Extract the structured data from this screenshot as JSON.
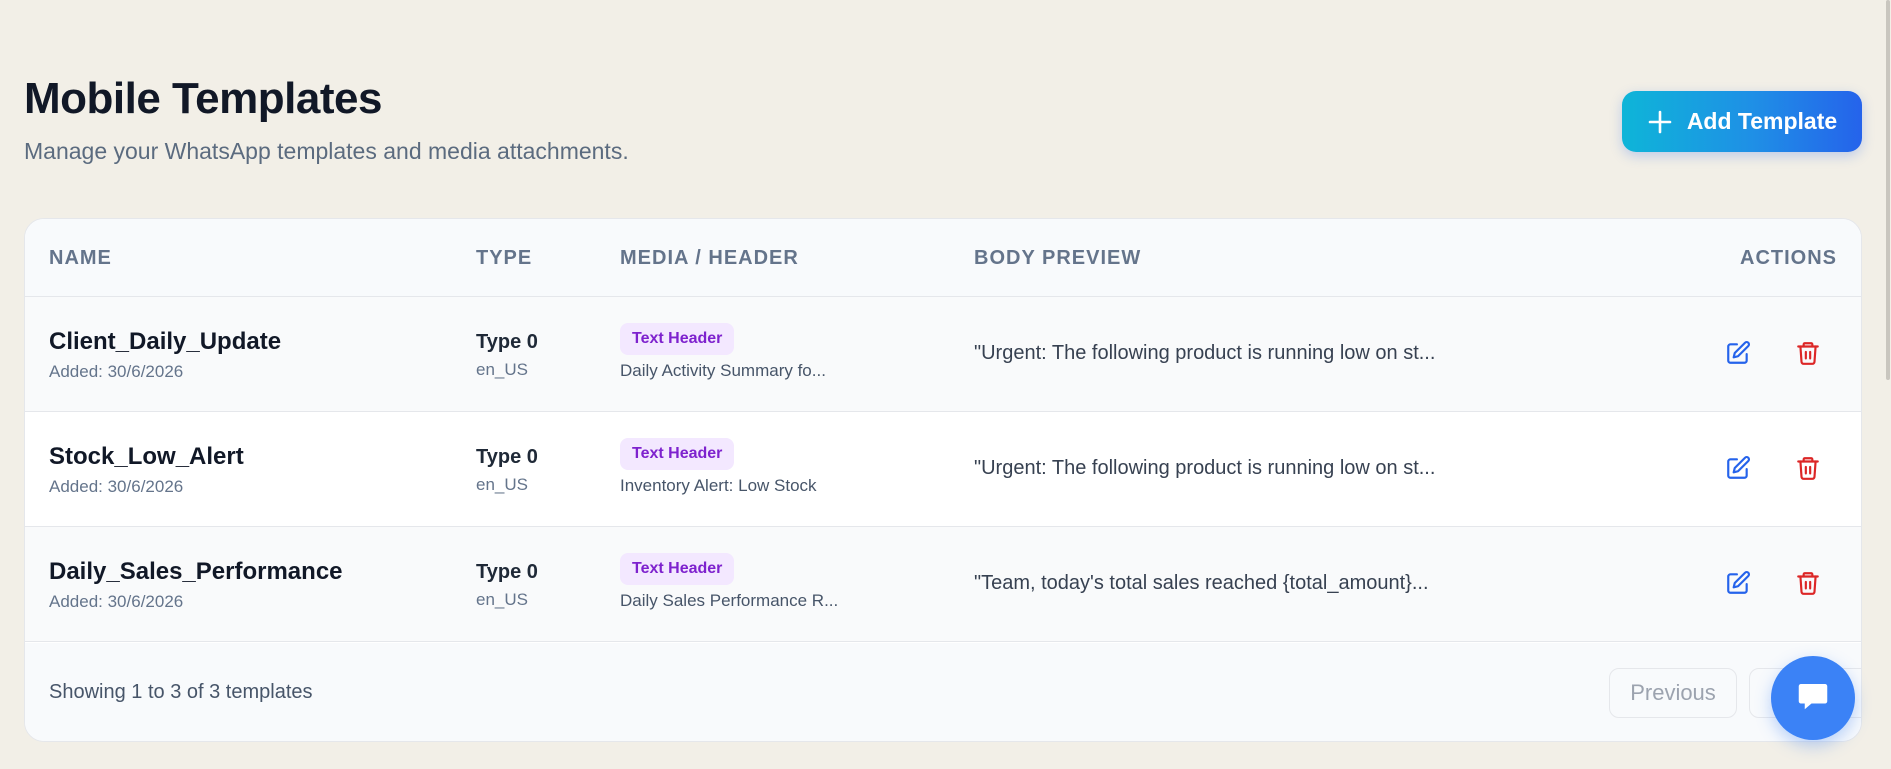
{
  "header": {
    "title": "Mobile Templates",
    "subtitle": "Manage your WhatsApp templates and media attachments.",
    "add_button_label": "Add Template",
    "add_button_icon": "plus-icon"
  },
  "table": {
    "columns": {
      "name": "NAME",
      "type": "TYPE",
      "media": "MEDIA / HEADER",
      "body": "BODY PREVIEW",
      "actions": "ACTIONS"
    },
    "rows": [
      {
        "name": "Client_Daily_Update",
        "added": "Added: 30/6/2026",
        "type": "Type 0",
        "locale": "en_US",
        "badge": "Text Header",
        "media": "Daily Activity Summary fo...",
        "preview": "\"Urgent: The following product is running low on st..."
      },
      {
        "name": "Stock_Low_Alert",
        "added": "Added: 30/6/2026",
        "type": "Type 0",
        "locale": "en_US",
        "badge": "Text Header",
        "media": "Inventory Alert: Low Stock",
        "preview": "\"Urgent: The following product is running low on st..."
      },
      {
        "name": "Daily_Sales_Performance",
        "added": "Added: 30/6/2026",
        "type": "Type 0",
        "locale": "en_US",
        "badge": "Text Header",
        "media": "Daily Sales Performance R...",
        "preview": "\"Team, today's total sales reached {total_amount}..."
      }
    ]
  },
  "footer": {
    "showing": "Showing 1 to 3 of 3 templates",
    "previous_label": "Previous"
  },
  "icons": {
    "edit": "edit-icon",
    "delete": "trash-icon",
    "chat": "chat-bubble-icon"
  },
  "colors": {
    "background": "#f2efe7",
    "accent_gradient_start": "#0eb5d8",
    "accent_gradient_end": "#2563eb",
    "badge_bg": "#f3e8ff",
    "badge_text": "#7e22ce",
    "edit_icon": "#2563eb",
    "delete_icon": "#dc2626",
    "chat_fab": "#3b82f6"
  }
}
